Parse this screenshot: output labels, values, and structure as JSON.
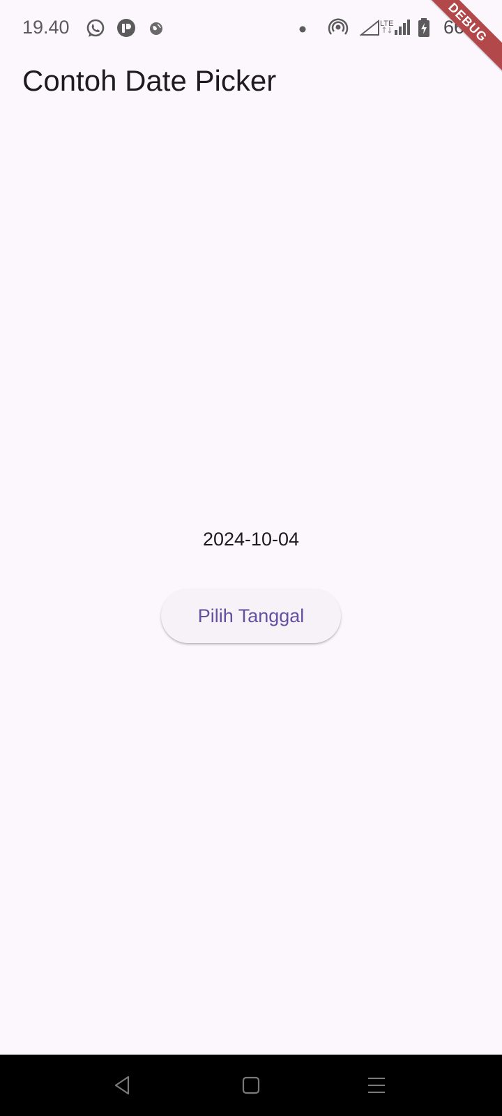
{
  "status_bar": {
    "time": "19.40",
    "battery_percent": "66%",
    "icons": [
      "whatsapp-icon",
      "app-notification-icon",
      "globe-icon",
      "dot-icon",
      "hotspot-icon",
      "signal-empty-icon",
      "lte-icon",
      "signal-bars-icon",
      "battery-charging-icon"
    ]
  },
  "debug_banner": {
    "label": "DEBUG",
    "color": "#b2484a"
  },
  "app_bar": {
    "title": "Contoh Date Picker"
  },
  "main": {
    "selected_date": "2024-10-04",
    "pick_button_label": "Pilih Tanggal"
  },
  "nav_bar": {
    "buttons": [
      "back-icon",
      "home-icon",
      "menu-icon"
    ]
  },
  "colors": {
    "background": "#fcf6fd",
    "button_text": "#65509f",
    "button_bg": "#f7f1f8"
  }
}
